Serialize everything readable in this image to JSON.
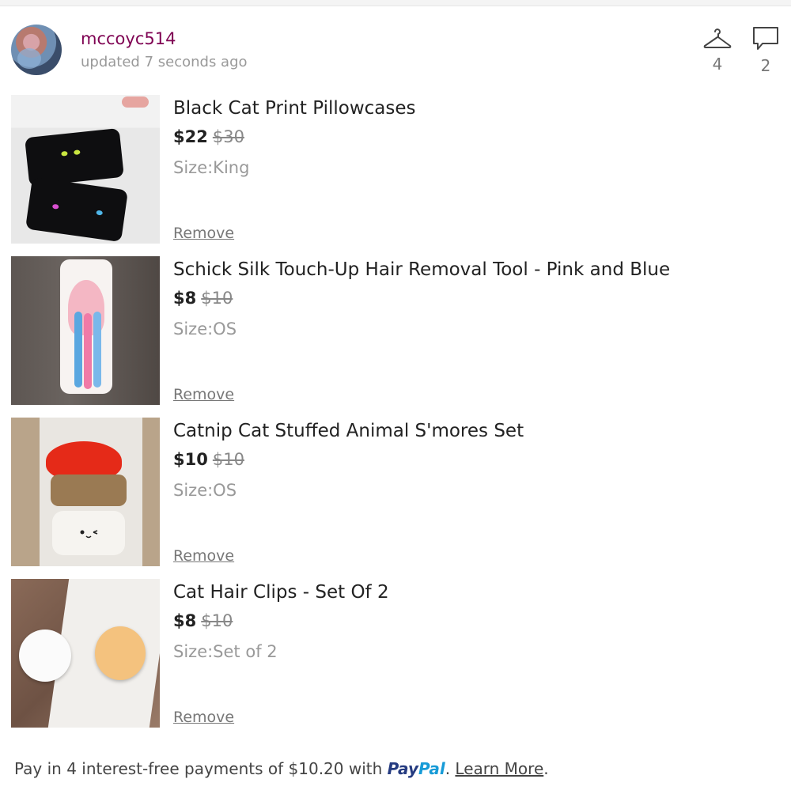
{
  "header": {
    "username": "mccoyc514",
    "updated": "updated 7 seconds ago",
    "likes_count": "4",
    "comments_count": "2"
  },
  "items": [
    {
      "title": "Black Cat Print Pillowcases",
      "price": "$22",
      "original_price": "$30",
      "size": "Size:King",
      "remove_label": "Remove"
    },
    {
      "title": "Schick Silk Touch-Up Hair Removal Tool - Pink and Blue",
      "price": "$8",
      "original_price": "$10",
      "size": "Size:OS",
      "remove_label": "Remove"
    },
    {
      "title": "Catnip Cat Stuffed Animal S'mores Set",
      "price": "$10",
      "original_price": "$10",
      "size": "Size:OS",
      "remove_label": "Remove"
    },
    {
      "title": "Cat Hair Clips - Set Of 2",
      "price": "$8",
      "original_price": "$10",
      "size": "Size:Set of 2",
      "remove_label": "Remove"
    }
  ],
  "footer": {
    "text_before": "Pay in 4 interest-free payments of $10.20 with",
    "paypal_pay": "Pay",
    "paypal_pal": "Pal",
    "period_after_logo": ".",
    "learn_more": "Learn More",
    "period_end": "."
  },
  "colors": {
    "username": "#7f0353",
    "paypal_pay": "#253b80",
    "paypal_pal": "#179bd7"
  }
}
